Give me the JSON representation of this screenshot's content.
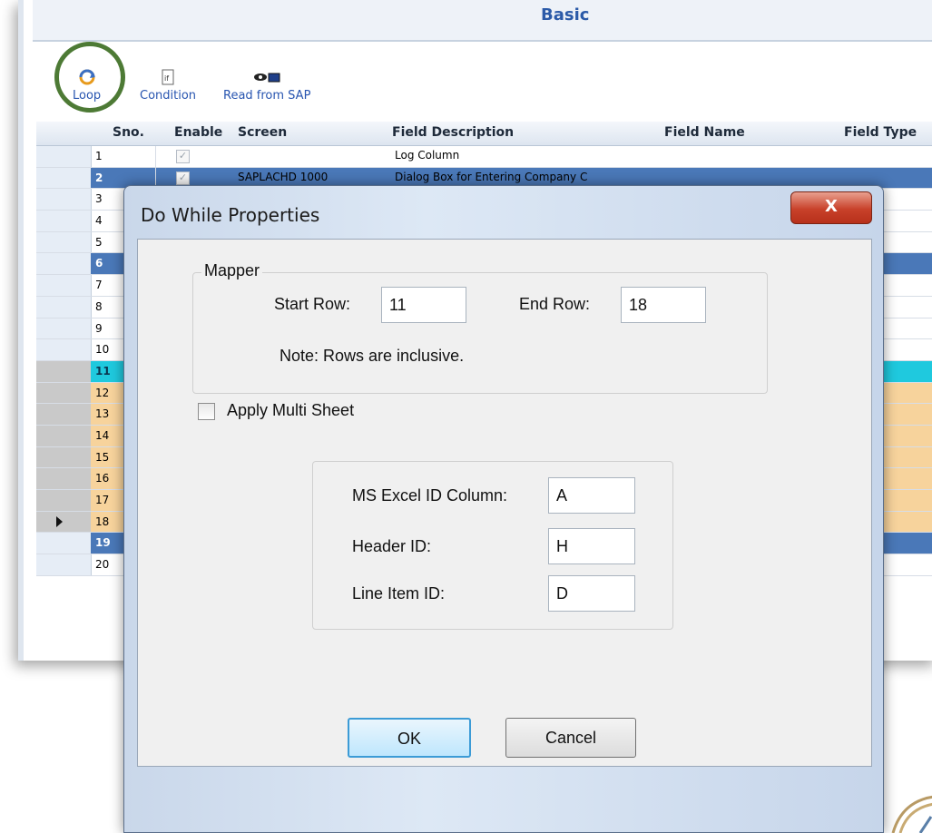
{
  "app": {
    "title": "Basic"
  },
  "toolbar": {
    "loop_label": "Loop",
    "condition_label": "Condition",
    "read_sap_label": "Read from SAP"
  },
  "grid": {
    "columns": [
      "Sno.",
      "Enable",
      "Screen",
      "Field Description",
      "Field Name",
      "Field Type"
    ],
    "rows": [
      {
        "sno": "1",
        "screen": "",
        "description": "Log Column",
        "style": "normal"
      },
      {
        "sno": "2",
        "screen": "SAPLACHD 1000",
        "description": "Dialog Box for Entering Company C",
        "style": "blue"
      },
      {
        "sno": "3",
        "style": "normal"
      },
      {
        "sno": "4",
        "style": "normal"
      },
      {
        "sno": "5",
        "style": "normal"
      },
      {
        "sno": "6",
        "style": "blue"
      },
      {
        "sno": "7",
        "style": "normal"
      },
      {
        "sno": "8",
        "style": "normal"
      },
      {
        "sno": "9",
        "style": "normal"
      },
      {
        "sno": "10",
        "style": "normal"
      },
      {
        "sno": "11",
        "style": "cyan"
      },
      {
        "sno": "12",
        "style": "orange"
      },
      {
        "sno": "13",
        "style": "orange"
      },
      {
        "sno": "14",
        "style": "orange"
      },
      {
        "sno": "15",
        "style": "orange"
      },
      {
        "sno": "16",
        "style": "orange"
      },
      {
        "sno": "17",
        "style": "orange"
      },
      {
        "sno": "18",
        "style": "orange"
      },
      {
        "sno": "19",
        "style": "blue"
      },
      {
        "sno": "20",
        "style": "normal"
      }
    ]
  },
  "dialog": {
    "title": "Do While Properties",
    "close_glyph": "X",
    "mapper": {
      "group_label": "Mapper",
      "start_row_label": "Start Row:",
      "start_row_value": "11",
      "end_row_label": "End Row:",
      "end_row_value": "18",
      "note": "Note: Rows are inclusive."
    },
    "multi_sheet": {
      "checkbox_label": "Apply Multi Sheet",
      "checked": false,
      "excel_id_label": "MS Excel ID Column:",
      "excel_id_value": "A",
      "header_id_label": "Header ID:",
      "header_id_value": "H",
      "line_item_label": "Line Item ID:",
      "line_item_value": "D"
    },
    "ok_label": "OK",
    "cancel_label": "Cancel"
  },
  "colors": {
    "row_blue": "#4a78b8",
    "row_cyan": "#1fc9de",
    "row_orange": "#f7d39c",
    "loop_highlight": "#4d7a35",
    "close_button": "#c8412a"
  }
}
